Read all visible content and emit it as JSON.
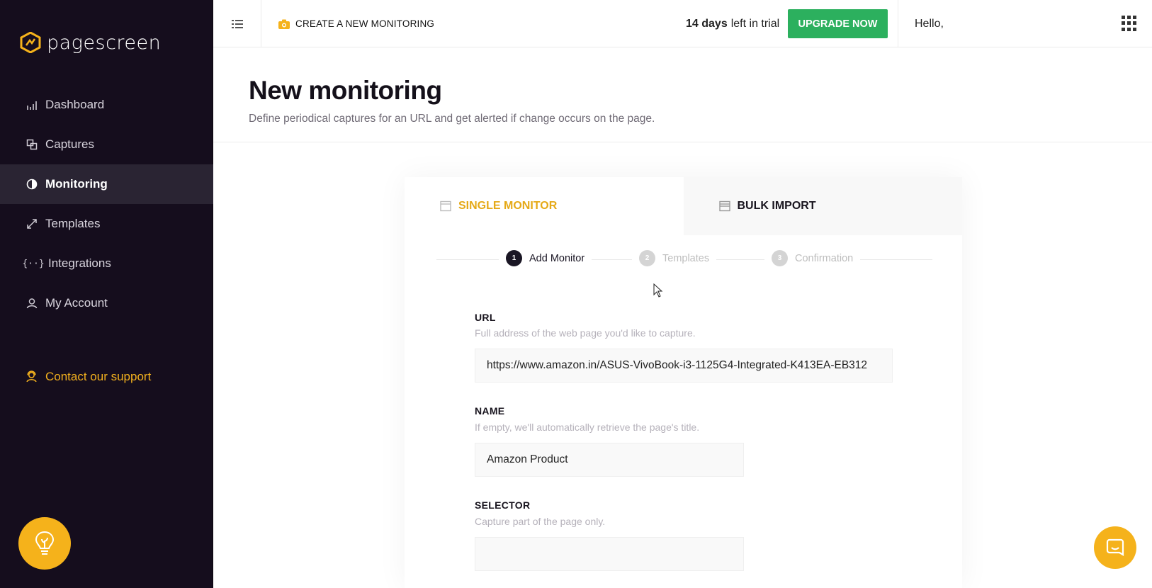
{
  "brand": {
    "name": "pagescreen",
    "accent": "#f5b21b",
    "sidebar_bg": "#150d1d"
  },
  "sidebar": {
    "items": [
      {
        "label": "Dashboard",
        "icon": "bar-chart-icon",
        "active": false
      },
      {
        "label": "Captures",
        "icon": "captures-icon",
        "active": false
      },
      {
        "label": "Monitoring",
        "icon": "half-circle-icon",
        "active": true
      },
      {
        "label": "Templates",
        "icon": "expand-icon",
        "active": false
      },
      {
        "label": "Integrations",
        "icon": "code-braces-icon",
        "active": false
      },
      {
        "label": "My Account",
        "icon": "user-icon",
        "active": false
      }
    ],
    "support_label": "Contact our support"
  },
  "topbar": {
    "breadcrumb": "CREATE A NEW MONITORING",
    "trial_days": "14 days",
    "trial_suffix": "left in trial",
    "upgrade_label": "UPGRADE NOW",
    "greeting": "Hello,"
  },
  "header": {
    "title": "New monitoring",
    "subtitle": "Define periodical captures for an URL and get alerted if change occurs on the page."
  },
  "tabs": [
    {
      "label": "SINGLE MONITOR",
      "active": true
    },
    {
      "label": "BULK IMPORT",
      "active": false
    }
  ],
  "steps": [
    {
      "num": "1",
      "label": "Add Monitor",
      "done": true
    },
    {
      "num": "2",
      "label": "Templates",
      "done": false
    },
    {
      "num": "3",
      "label": "Confirmation",
      "done": false
    }
  ],
  "form": {
    "url": {
      "label": "URL",
      "help": "Full address of the web page you'd like to capture.",
      "value": "https://www.amazon.in/ASUS-VivoBook-i3-1125G4-Integrated-K413EA-EB312"
    },
    "name": {
      "label": "NAME",
      "help": "If empty, we'll automatically retrieve the page's title.",
      "value": "Amazon Product"
    },
    "selector": {
      "label": "SELECTOR",
      "help": "Capture part of the page only.",
      "value": ""
    }
  }
}
